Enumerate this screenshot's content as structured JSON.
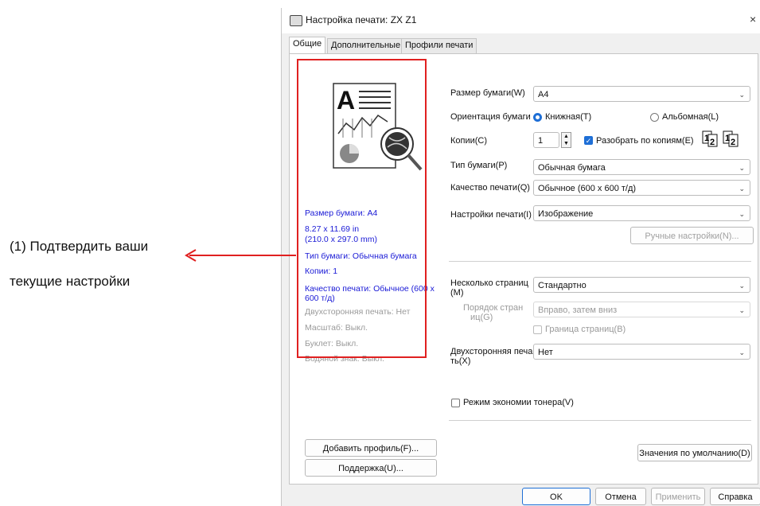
{
  "annotation": {
    "line1": "(1) Подтвердить ваши",
    "line2": "текущие настройки"
  },
  "window": {
    "title": "Настройка печати: ZX Z1",
    "close": "×"
  },
  "tabs": [
    {
      "label": "Общие"
    },
    {
      "label": "Дополнительные"
    },
    {
      "label": "Профили печати"
    }
  ],
  "summary": [
    {
      "text": "Размер бумаги: A4"
    },
    {
      "text": "8.27 x 11.69 in"
    },
    {
      "text": "(210.0 x 297.0 mm)"
    },
    {
      "text": "Тип бумаги: Обычная бумага"
    },
    {
      "text": "Копии: 1"
    },
    {
      "text": "Качество печати: Обычное (600 x"
    },
    {
      "text": "600 т/д)"
    },
    {
      "text": "Двухсторонняя печать: Нет"
    },
    {
      "text": "Масштаб: Выкл."
    },
    {
      "text": "Буклет: Выкл."
    },
    {
      "text": "Водяной знак: Выкл."
    }
  ],
  "settings": {
    "paper_size_label": "Размер бумаги(W)",
    "paper_size_value": "A4",
    "orientation_label": "Ориентация бумаги",
    "portrait": "Книжная(T)",
    "landscape": "Альбомная(L)",
    "copies_label": "Копии(C)",
    "copies_value": "1",
    "collate_label": "Разобрать по копиям(E)",
    "paper_type_label": "Тип бумаги(P)",
    "paper_type_value": "Обычная бумага",
    "quality_label": "Качество печати(Q)",
    "quality_value": "Обычное (600 x 600 т/д)",
    "print_settings_label": "Настройки печати(I)",
    "print_settings_value": "Изображение",
    "manual_button": "Ручные настройки(N)...",
    "multipage_label_1": "Несколько страниц",
    "multipage_label_2": "(M)",
    "multipage_value": "Стандартно",
    "page_order_label_1": "Порядок стран",
    "page_order_label_2": "иц(G)",
    "page_order_value": "Вправо, затем вниз",
    "border_label": "Граница страниц(B)",
    "duplex_label_1": "Двухсторонняя печа",
    "duplex_label_2": "ть(X)",
    "duplex_value": "Нет",
    "toner_save_label": "Режим экономии тонера(V)"
  },
  "buttons": {
    "add_profile": "Добавить профиль(F)...",
    "support": "Поддержка(U)...",
    "defaults": "Значения по умолчанию(D)",
    "ok": "OK",
    "cancel": "Отмена",
    "apply": "Применить",
    "help": "Справка"
  },
  "colors": {
    "annotation_red": "#e02020",
    "summary_blue": "#1a1ad6",
    "accent": "#1f6fd6"
  }
}
